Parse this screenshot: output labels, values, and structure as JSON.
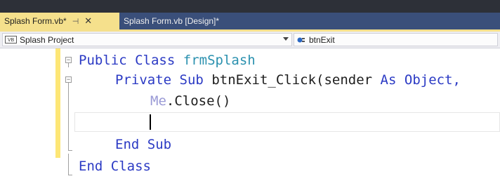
{
  "tabs": [
    {
      "label": "Splash Form.vb*",
      "active": true
    },
    {
      "label": "Splash Form.vb [Design]*",
      "active": false
    }
  ],
  "tab_pin_glyph": "⊣",
  "tab_close_glyph": "✕",
  "nav": {
    "project_badge": "VB",
    "project": "Splash Project",
    "member": "btnExit"
  },
  "code": {
    "line1": {
      "kw1": "Public",
      "kw2": "Class",
      "name": "frmSplash"
    },
    "line2": {
      "kw1": "Private",
      "kw2": "Sub",
      "rest": "btnExit_Click(sender",
      "kw3": "As",
      "type": "Object,"
    },
    "line3": {
      "me": "Me",
      "rest": ".Close()"
    },
    "line5": {
      "kw1": "End",
      "kw2": "Sub"
    },
    "line6": {
      "kw1": "End",
      "kw2": "Class"
    }
  },
  "colors": {
    "tab_active": "#f5e08c",
    "keyword": "#2b3ac4",
    "type": "#2b91af"
  }
}
